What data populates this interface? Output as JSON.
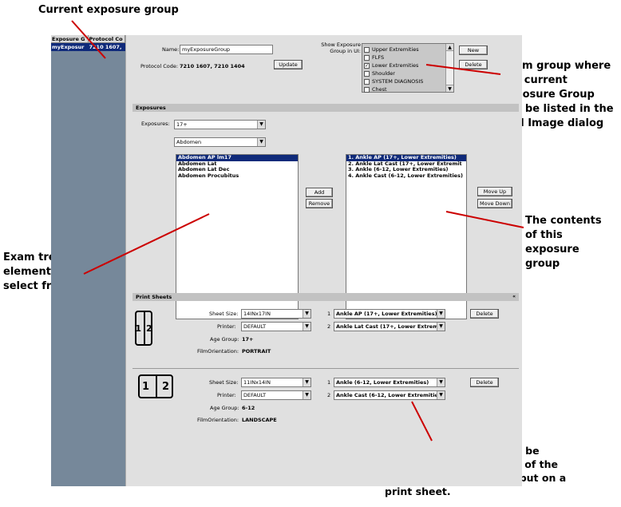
{
  "annotations": {
    "current_group": "Current exposure group",
    "exam_group": [
      "Exam group where",
      "the current",
      "Exposure Group",
      "will be listed in the",
      "Add Image dialog"
    ],
    "exam_tree": [
      "Exam tree",
      "elements to",
      "select from"
    ],
    "contents": [
      "The contents",
      "of this",
      "exposure",
      "group"
    ],
    "print_sheets_note": [
      "Several print sheets can be",
      "defined. Only exposures of the",
      "same age group can be put on a",
      "print sheet."
    ]
  },
  "left_panel": {
    "col1": "Exposure G",
    "col2": "Protocol Co",
    "row_name": "myExposur",
    "row_code": "7210 1607,"
  },
  "header": {
    "name_label": "Name:",
    "name_value": "myExposureGroup",
    "protocol_label": "Protocol Code:",
    "protocol_value": "7210 1607, 7210 1404",
    "update_btn": "Update",
    "show_label_1": "Show Exposure",
    "show_label_2": "Group in UI:",
    "groups": [
      {
        "label": "Upper Extremities",
        "checked": false
      },
      {
        "label": "FLFS",
        "checked": false
      },
      {
        "label": "Lower Extremities",
        "checked": true
      },
      {
        "label": "Shoulder",
        "checked": false
      },
      {
        "label": "SYSTEM DIAGNOSIS",
        "checked": false
      },
      {
        "label": "Chest",
        "checked": false
      }
    ],
    "new_btn": "New",
    "delete_btn": "Delete"
  },
  "exposures": {
    "section_title": "Exposures",
    "exposures_label": "Exposures:",
    "age_select": "17+",
    "body_select": "Abdomen",
    "source_list": [
      "Abdomen AP lm17",
      "Abdomen Lat",
      "Abdomen Lat Dec",
      "Abdomen Procubitus"
    ],
    "target_list": [
      "1. Ankle AP (17+, Lower Extremities)",
      "2. Ankle Lat Cast (17+, Lower Extremit",
      "3. Ankle (6-12, Lower Extremities)",
      "4. Ankle Cast (6-12, Lower Extremities)"
    ],
    "add_btn": "Add",
    "remove_btn": "Remove",
    "move_up_btn": "Move Up",
    "move_down_btn": "Move Down"
  },
  "print_sheets": {
    "section_title": "Print Sheets",
    "sheet_size_label": "Sheet Size:",
    "printer_label": "Printer:",
    "age_group_label": "Age Group:",
    "film_orientation_label": "FilmOrientation:",
    "delete_btn": "Delete",
    "sheets": [
      {
        "size": "14INx17IN",
        "printer": "DEFAULT",
        "age": "17+",
        "orientation": "PORTRAIT",
        "slot1_num": "1",
        "slot1": "Ankle AP (17+, Lower Extremities)",
        "slot2_num": "2",
        "slot2": "Ankle Lat Cast (17+, Lower Extremi"
      },
      {
        "size": "11INx14IN",
        "printer": "DEFAULT",
        "age": "6-12",
        "orientation": "LANDSCAPE",
        "slot1_num": "1",
        "slot1": "Ankle (6-12, Lower Extremities)",
        "slot2_num": "2",
        "slot2": "Ankle Cast (6-12, Lower Extremitie"
      }
    ],
    "sheet_digits": [
      "1",
      "2"
    ]
  },
  "icons": [
    "chevron-down-icon",
    "checkbox-icon",
    "scroll-up-icon",
    "scroll-down-icon",
    "minimize-icon"
  ],
  "colors": {
    "selection": "#0f2a7a",
    "annotation_line": "#cc0000",
    "panel": "#e0e0e0",
    "left_panel": "#76889a"
  }
}
